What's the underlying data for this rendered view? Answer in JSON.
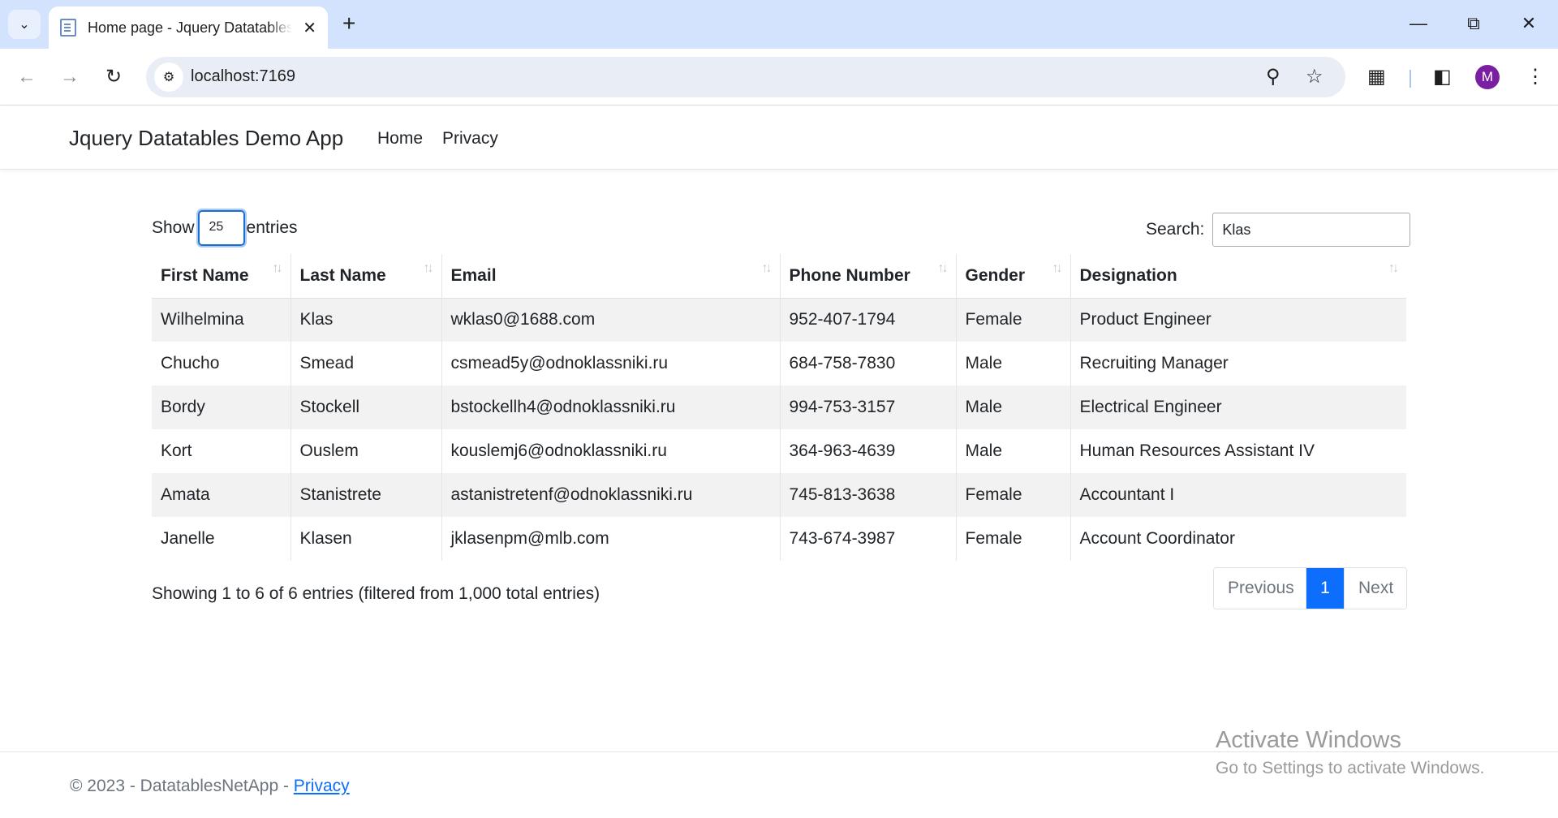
{
  "browser": {
    "tab_title": "Home page - Jquery Datatables Demo App",
    "url": "localhost:7169",
    "avatar_letter": "M"
  },
  "navbar": {
    "brand": "Jquery Datatables Demo App",
    "links": [
      "Home",
      "Privacy"
    ]
  },
  "datatable": {
    "show_label": "Show",
    "page_length": "25",
    "entries_label": "entries",
    "search_label": "Search:",
    "search_value": "Klas",
    "columns": [
      "First Name",
      "Last Name",
      "Email",
      "Phone Number",
      "Gender",
      "Designation"
    ],
    "rows": [
      [
        "Wilhelmina",
        "Klas",
        "wklas0@1688.com",
        "952-407-1794",
        "Female",
        "Product Engineer"
      ],
      [
        "Chucho",
        "Smead",
        "csmead5y@odnoklassniki.ru",
        "684-758-7830",
        "Male",
        "Recruiting Manager"
      ],
      [
        "Bordy",
        "Stockell",
        "bstockellh4@odnoklassniki.ru",
        "994-753-3157",
        "Male",
        "Electrical Engineer"
      ],
      [
        "Kort",
        "Ouslem",
        "kouslemj6@odnoklassniki.ru",
        "364-963-4639",
        "Male",
        "Human Resources Assistant IV"
      ],
      [
        "Amata",
        "Stanistrete",
        "astanistretenf@odnoklassniki.ru",
        "745-813-3638",
        "Female",
        "Accountant I"
      ],
      [
        "Janelle",
        "Klasen",
        "jklasenpm@mlb.com",
        "743-674-3987",
        "Female",
        "Account Coordinator"
      ]
    ],
    "info": "Showing 1 to 6 of 6 entries (filtered from 1,000 total entries)",
    "pagination": {
      "previous": "Previous",
      "current": "1",
      "next": "Next"
    }
  },
  "watermark": {
    "title": "Activate Windows",
    "subtitle": "Go to Settings to activate Windows."
  },
  "footer": {
    "text": "© 2023 - DatatablesNetApp - ",
    "link": "Privacy"
  },
  "colors": {
    "accent": "#0d6efd",
    "striped_row": "#f2f2f2",
    "tab_strip": "#d3e3fd"
  }
}
